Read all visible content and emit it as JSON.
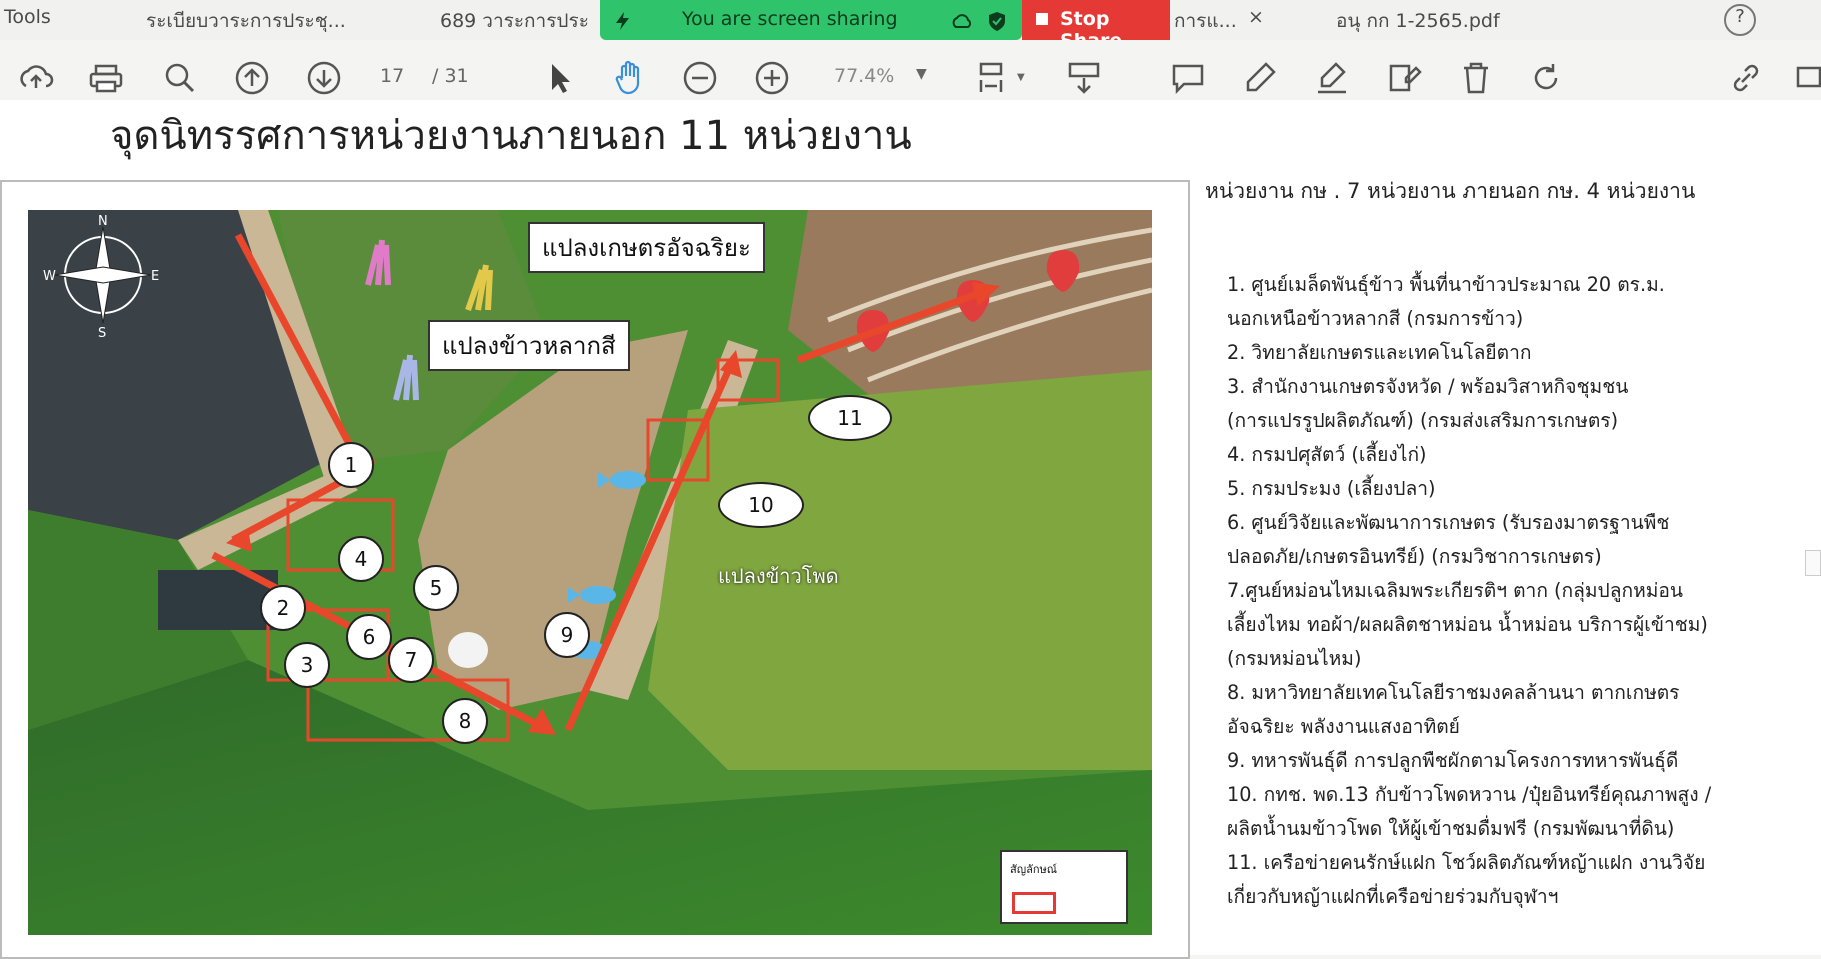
{
  "tabbar": {
    "tabs": [
      {
        "label": "Tools"
      },
      {
        "label": "ระเบียบวาระการประชุ..."
      },
      {
        "label": "689 วาระการประ"
      },
      {
        "label": "การแ..."
      },
      {
        "label": "×"
      },
      {
        "label": "อนุ กก 1-2565.pdf"
      }
    ],
    "share_notice": "You are screen sharing",
    "stop_share": "Stop Share"
  },
  "toolbar": {
    "page_current": "17",
    "page_total": "/ 31",
    "zoom": "77.4%",
    "icons": [
      "upload-icon",
      "print-icon",
      "search-icon",
      "page-up-icon",
      "page-down-icon",
      "select-arrow-icon",
      "hand-icon",
      "zoom-out-icon",
      "zoom-in-icon",
      "fit-page-icon",
      "scroll-mode-icon",
      "comment-icon",
      "highlight-icon",
      "sign-icon",
      "edit-icon",
      "delete-icon",
      "rotate-icon",
      "link-icon"
    ]
  },
  "document": {
    "title": "จุดนิทรรศการหน่วยงานภายนอก 11 หน่วยงาน",
    "map": {
      "labels": {
        "smart_farm": "แปลงเกษตรอัจฉริยะ",
        "colorful_rice": "แปลงข้าวหลากสี",
        "corn_field": "แปลงข้าวโพด"
      },
      "markers": [
        "1",
        "2",
        "3",
        "4",
        "5",
        "6",
        "7",
        "8",
        "9",
        "10",
        "11"
      ],
      "legend_title": "สัญลักษณ์"
    },
    "panel": {
      "heading": "หน่วยงาน กษ . 7 หน่วยงาน ภายนอก กษ. 4 หน่วยงาน",
      "lines": [
        "1. ศูนย์เมล็ดพันธุ์ข้าว พื้นที่นาข้าวประมาณ 20 ตร.ม.",
        "นอกเหนือข้าวหลากสี (กรมการข้าว)",
        "2. วิทยาลัยเกษตรและเทคโนโลยีตาก",
        "3. สำนักงานเกษตรจังหวัด / พร้อมวิสาหกิจชุมชน",
        "(การแปรรูปผลิตภัณฑ์) (กรมส่งเสริมการเกษตร)",
        "4. กรมปศุสัตว์ (เลี้ยงไก่)",
        "5. กรมประมง (เลี้ยงปลา)",
        "6. ศูนย์วิจัยและพัฒนาการเกษตร (รับรองมาตรฐานพืช",
        "ปลอดภัย/เกษตรอินทรีย์) (กรมวิชาการเกษตร)",
        "7.ศูนย์หม่อนไหมเฉลิมพระเกียรติฯ ตาก (กลุ่มปลูกหม่อน",
        "เลี้ยงไหม ทอผ้า/ผลผลิตชาหม่อน น้ำหม่อน บริการผู้เข้าชม)",
        "(กรมหม่อนไหม)",
        "8. มหาวิทยาลัยเทคโนโลยีราชมงคลล้านนา ตากเกษตร",
        "อัจฉริยะ พลังงานแสงอาทิตย์",
        "9. ทหารพันธุ์ดี การปลูกพืชผักตามโครงการทหารพันธุ์ดี",
        "10. กทช. พด.13 กับข้าวโพดหวาน /ปุ๋ยอินทรีย์คุณภาพสูง /",
        "ผลิตน้ำนมข้าวโพด ให้ผู้เข้าชมดื่มฟรี (กรมพัฒนาที่ดิน)",
        "11. เครือข่ายคนรักษ์แฝก โชว์ผลิตภัณฑ์หญ้าแฝก งานวิจัย",
        "เกี่ยวกับหญ้าแฝกที่เครือข่ายร่วมกับจุฬาฯ"
      ]
    }
  },
  "colors": {
    "share_green": "#2fc46b",
    "stop_red": "#e53935",
    "route_red": "#e8472b"
  }
}
